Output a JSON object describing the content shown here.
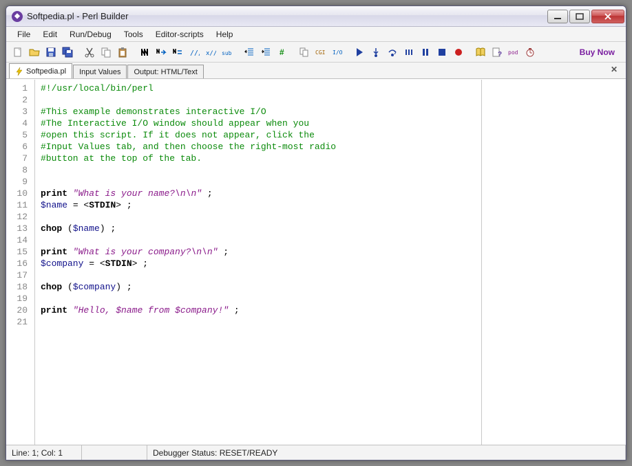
{
  "window": {
    "title": "Softpedia.pl - Perl Builder"
  },
  "menu": {
    "items": [
      "File",
      "Edit",
      "Run/Debug",
      "Tools",
      "Editor-scripts",
      "Help"
    ]
  },
  "toolbar": {
    "icons": [
      "new-file-icon",
      "open-folder-icon",
      "save-icon",
      "save-all-icon",
      "sep",
      "cut-icon",
      "copy-icon",
      "paste-icon",
      "sep",
      "find-icon",
      "find-next-icon",
      "replace-icon",
      "comment-icon",
      "uncomment-icon",
      "sub-icon",
      "sep",
      "outdent-icon",
      "indent-icon",
      "bookmark-icon",
      "sep",
      "multi-doc-icon",
      "cgi-icon",
      "io-icon",
      "sep",
      "run-icon",
      "step-into-icon",
      "step-over-icon",
      "step-out-icon",
      "pause-icon",
      "stop-icon",
      "record-icon",
      "sep",
      "help-book-icon",
      "context-help-icon",
      "pod-icon",
      "timer-icon"
    ],
    "buy_now": "Buy Now"
  },
  "tabs": {
    "items": [
      {
        "label": "Softpedia.pl",
        "active": true,
        "icon": "lightning-icon"
      },
      {
        "label": "Input Values",
        "active": false
      },
      {
        "label": "Output: HTML/Text",
        "active": false
      }
    ]
  },
  "editor": {
    "lines": [
      [
        {
          "t": "comment",
          "v": "#!/usr/local/bin/perl"
        }
      ],
      [],
      [
        {
          "t": "comment",
          "v": "#This example demonstrates interactive I/O"
        }
      ],
      [
        {
          "t": "comment",
          "v": "#The Interactive I/O window should appear when you"
        }
      ],
      [
        {
          "t": "comment",
          "v": "#open this script. If it does not appear, click the"
        }
      ],
      [
        {
          "t": "comment",
          "v": "#Input Values tab, and then choose the right-most radio"
        }
      ],
      [
        {
          "t": "comment",
          "v": "#button at the top of the tab."
        }
      ],
      [],
      [],
      [
        {
          "t": "keyword",
          "v": "print"
        },
        {
          "t": "plain",
          "v": " "
        },
        {
          "t": "string",
          "v": "\"What is your name?\\n\\n\""
        },
        {
          "t": "plain",
          "v": " ;"
        }
      ],
      [
        {
          "t": "variable",
          "v": "$name"
        },
        {
          "t": "plain",
          "v": " = <"
        },
        {
          "t": "bare",
          "v": "STDIN"
        },
        {
          "t": "plain",
          "v": "> ;"
        }
      ],
      [],
      [
        {
          "t": "keyword",
          "v": "chop"
        },
        {
          "t": "plain",
          "v": " ("
        },
        {
          "t": "variable",
          "v": "$name"
        },
        {
          "t": "plain",
          "v": ") ;"
        }
      ],
      [],
      [
        {
          "t": "keyword",
          "v": "print"
        },
        {
          "t": "plain",
          "v": " "
        },
        {
          "t": "string",
          "v": "\"What is your company?\\n\\n\""
        },
        {
          "t": "plain",
          "v": " ;"
        }
      ],
      [
        {
          "t": "variable",
          "v": "$company"
        },
        {
          "t": "plain",
          "v": " = <"
        },
        {
          "t": "bare",
          "v": "STDIN"
        },
        {
          "t": "plain",
          "v": "> ;"
        }
      ],
      [],
      [
        {
          "t": "keyword",
          "v": "chop"
        },
        {
          "t": "plain",
          "v": " ("
        },
        {
          "t": "variable",
          "v": "$company"
        },
        {
          "t": "plain",
          "v": ") ;"
        }
      ],
      [],
      [
        {
          "t": "keyword",
          "v": "print"
        },
        {
          "t": "plain",
          "v": " "
        },
        {
          "t": "string",
          "v": "\"Hello, $name from $company!\""
        },
        {
          "t": "plain",
          "v": " ;"
        }
      ],
      []
    ]
  },
  "status": {
    "position": "Line: 1; Col: 1",
    "debugger": "Debugger Status: RESET/READY"
  },
  "colors": {
    "accent": "#7a1ea0",
    "comment": "#0a8a0a",
    "string": "#8a1a8a",
    "variable": "#10108a"
  }
}
